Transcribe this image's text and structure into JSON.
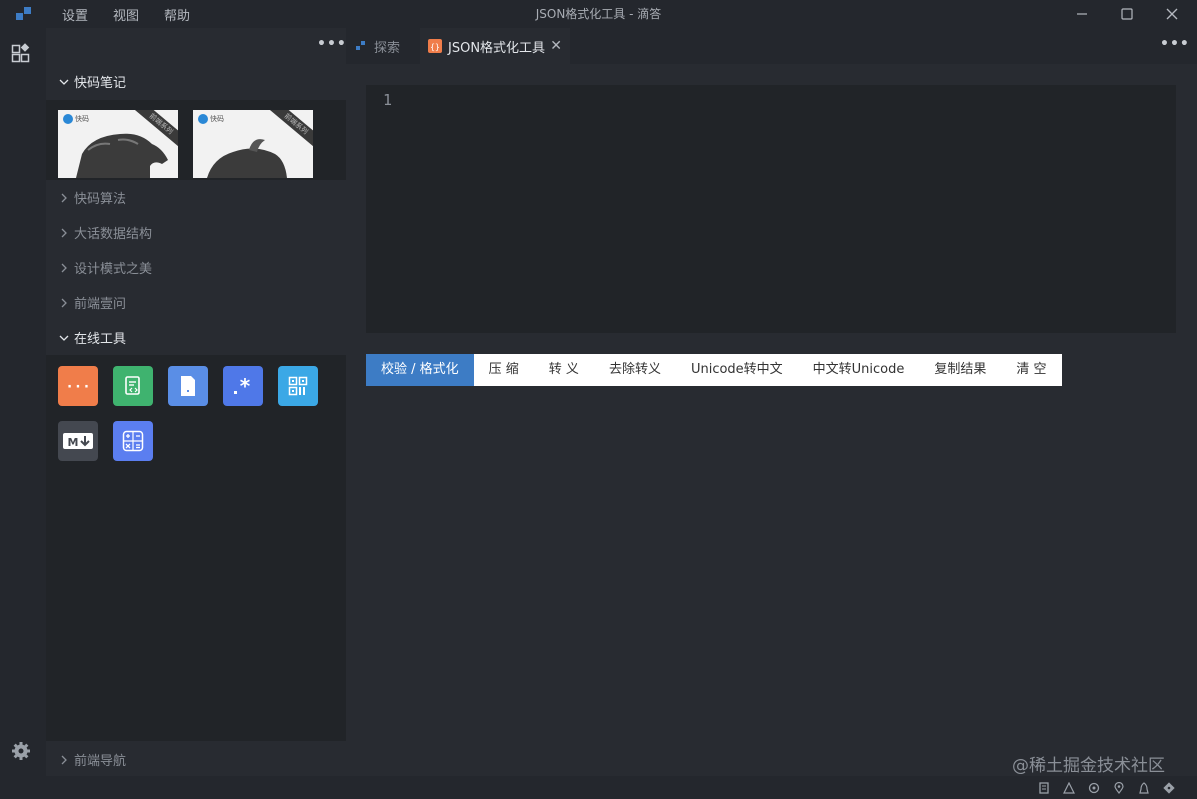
{
  "titlebar": {
    "menu": [
      "设置",
      "视图",
      "帮助"
    ],
    "title": "JSON格式化工具 - 滴答"
  },
  "tabs": {
    "explore_label": "探索",
    "active_label": "JSON格式化工具"
  },
  "sidebar": {
    "sections": [
      {
        "label": "快码笔记",
        "open": true
      },
      {
        "label": "快码算法",
        "open": false
      },
      {
        "label": "大话数据结构",
        "open": false
      },
      {
        "label": "设计模式之美",
        "open": false
      },
      {
        "label": "前端壹问",
        "open": false
      },
      {
        "label": "在线工具",
        "open": true
      },
      {
        "label": "前端导航",
        "open": false
      }
    ],
    "thumbnails": [
      {
        "brand": "快码",
        "ribbon": "前端系列"
      },
      {
        "brand": "快码",
        "ribbon": "前端系列"
      }
    ],
    "tools": [
      {
        "icon": "json-braces-icon",
        "color": "#f07d4a"
      },
      {
        "icon": "document-code-icon",
        "color": "#3fb36f"
      },
      {
        "icon": "file-icon",
        "color": "#5a8ee6"
      },
      {
        "icon": "regex-icon",
        "color": "#4f78e8"
      },
      {
        "icon": "qrcode-icon",
        "color": "#3ba8e6"
      },
      {
        "icon": "markdown-icon",
        "color": "#444850"
      },
      {
        "icon": "calculator-icon",
        "color": "#5b7ef0"
      }
    ]
  },
  "editor": {
    "line_number": "1"
  },
  "toolbar": {
    "buttons": [
      "校验 / 格式化",
      "压 缩",
      "转 义",
      "去除转义",
      "Unicode转中文",
      "中文转Unicode",
      "复制结果",
      "清 空"
    ]
  },
  "watermark": "@稀土掘金技术社区",
  "colors": {
    "accent": "#3d7cc5",
    "background": "#282b31",
    "panel": "#212428"
  }
}
